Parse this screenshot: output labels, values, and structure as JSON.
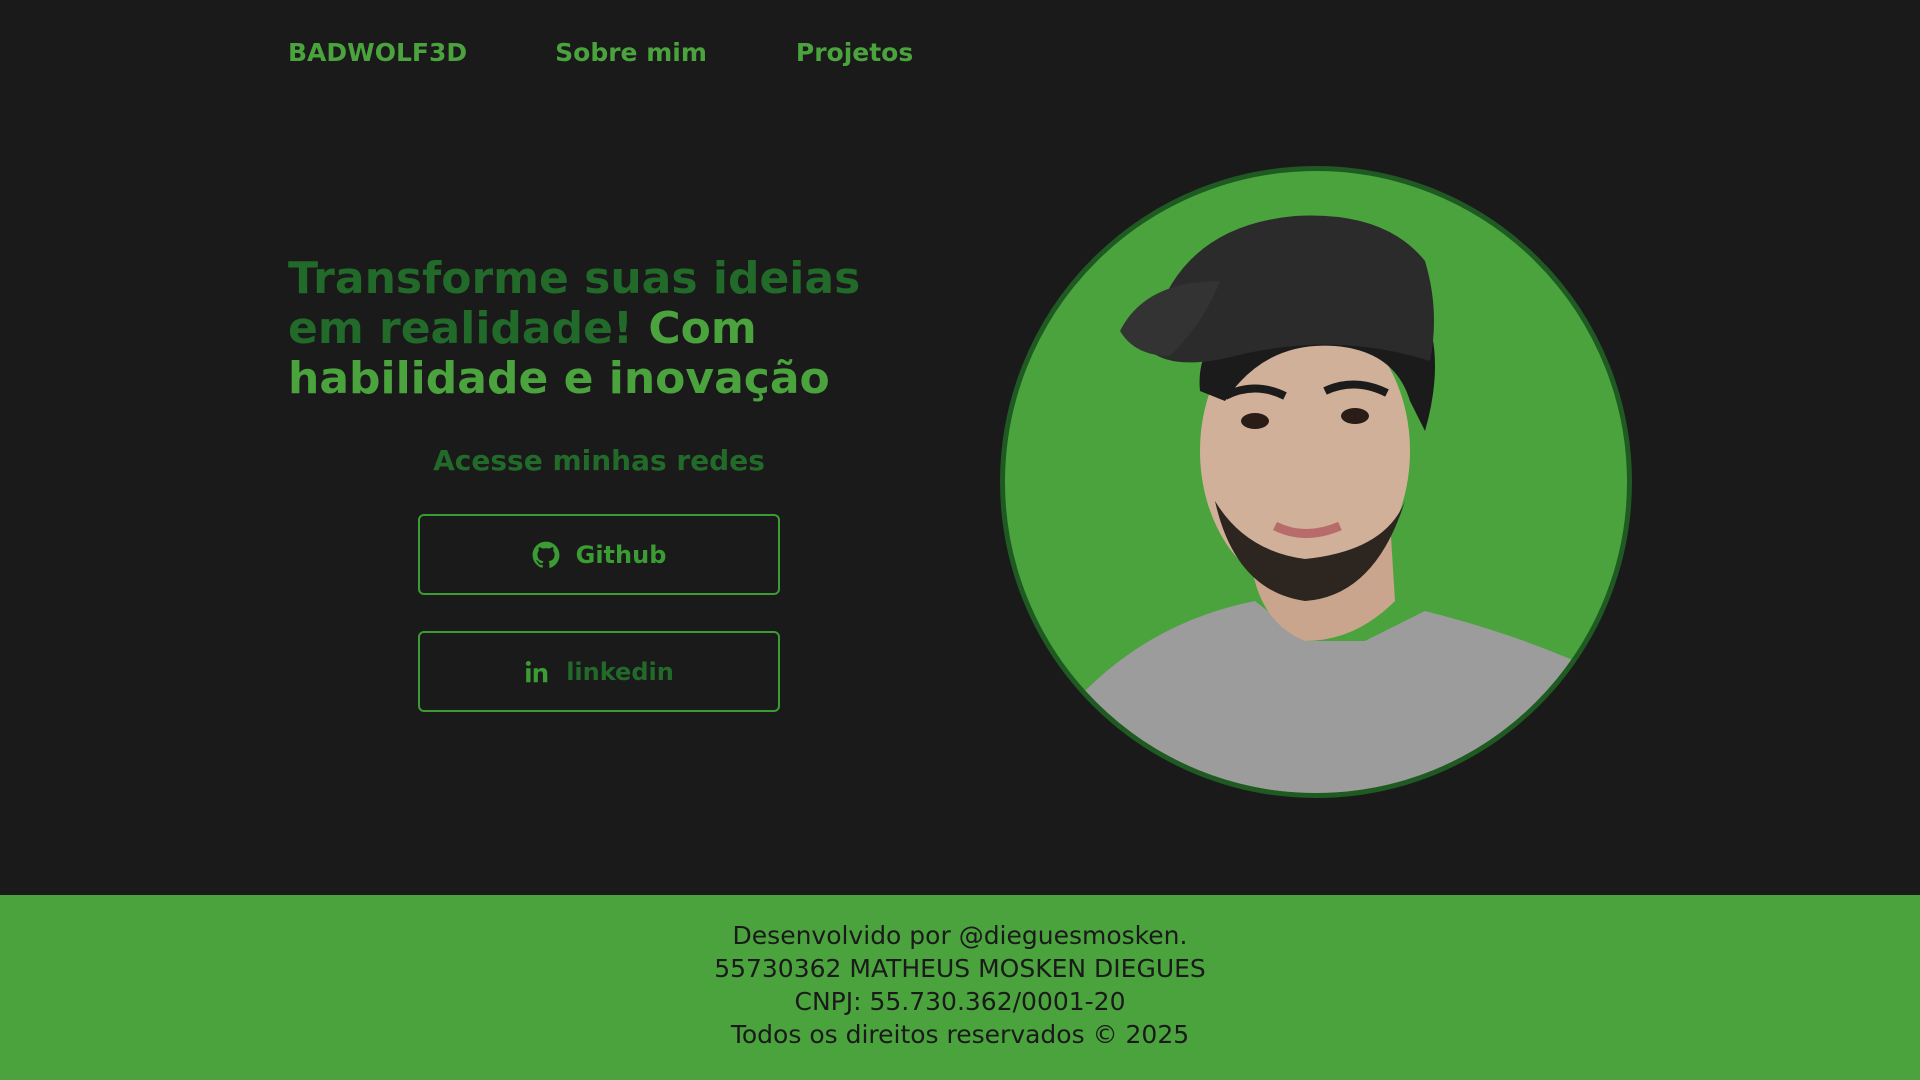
{
  "nav": {
    "brand": "BADWOLF3D",
    "links": [
      "Sobre mim",
      "Projetos"
    ]
  },
  "hero": {
    "title_dim": "Transforme suas ideias em realidade!",
    "title_bright": "Com habilidade e inovação"
  },
  "networks": {
    "title": "Acesse minhas redes",
    "github_label": "Github",
    "github_icon": "github-icon",
    "linkedin_label": "linkedin",
    "linkedin_icon": "linkedin-icon"
  },
  "profile": {
    "image": "profile-photo"
  },
  "footer": {
    "lines": [
      "Desenvolvido por @dieguesmosken.",
      "55730362 MATHEUS MOSKEN DIEGUES",
      "CNPJ: 55.730.362/0001-20",
      "Todos os direitos reservados © 2025"
    ]
  },
  "colors": {
    "background": "#1a1a1a",
    "accent": "#4aa33d",
    "accent_dark": "#226a2a"
  }
}
